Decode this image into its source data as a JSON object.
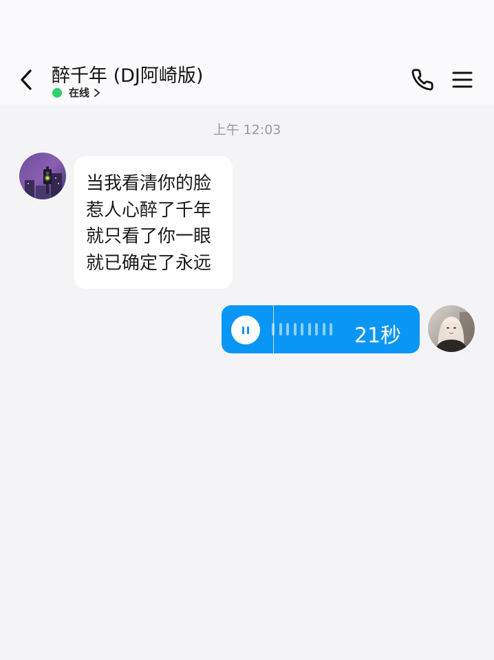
{
  "header": {
    "title": "醉千年 (DJ阿崎版)",
    "status": "在线",
    "status_color": "#2fd16a"
  },
  "chat": {
    "timestamp": "上午 12:03",
    "incoming_message": {
      "lines": [
        "当我看清你的脸",
        "惹人心醉了千年",
        "就只看了你一眼",
        "就已确定了永远"
      ]
    },
    "voice_message": {
      "duration": "21秒",
      "state": "playing",
      "bubble_color": "#0a96f4"
    }
  },
  "icons": {
    "back": "chevron-left-icon",
    "call": "phone-icon",
    "menu": "menu-icon",
    "pause": "pause-icon"
  }
}
